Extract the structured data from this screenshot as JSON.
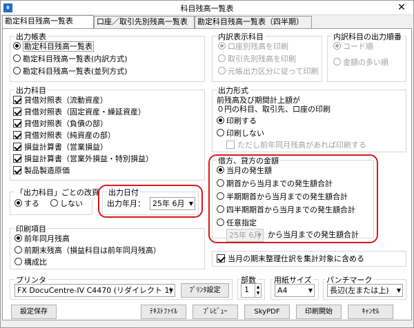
{
  "window": {
    "title": "科目残高一覧表",
    "app_icon": "B"
  },
  "tabs": [
    "勘定科目残高一覧表",
    "口座／取引先別残高一覧表",
    "勘定科目残高一覧表（四半期）"
  ],
  "output_ledger": {
    "legend": "出力帳表",
    "options": [
      "勘定科目残高一覧表",
      "勘定科目残高一覧表(内訳方式)",
      "勘定科目残高一覧表(並列方式)"
    ],
    "selected": 0
  },
  "breakdown": {
    "legend": "内訳表示科目",
    "options": [
      "口座別残高を印刷",
      "取引先別残高を印刷",
      "元帳出力区分に従って印刷"
    ]
  },
  "breakdown_order": {
    "legend": "内訳科目の出力順番",
    "options": [
      "コード順",
      "金額の多い順"
    ]
  },
  "output_accounts": {
    "legend": "出力科目",
    "items": [
      "貸借対照表（流動資産）",
      "貸借対照表（固定資産・繰延資産）",
      "貸借対照表（負債の部）",
      "貸借対照表（純資産の部）",
      "損益計算書（営業損益）",
      "損益計算書（営業外損益・特別損益）",
      "製品製造原価"
    ]
  },
  "output_format": {
    "legend": "出力形式",
    "desc1": "前残高及び期間計上額が",
    "desc2": "０円の科目、取引先、口座の印刷",
    "options": [
      "印刷する",
      "印刷しない"
    ],
    "sub_check": "ただし前年同月残高があれば印刷する"
  },
  "page_break": {
    "legend": "「出力科目」ごとの改頁",
    "options": [
      "する",
      "しない"
    ]
  },
  "output_date": {
    "legend": "出力日付",
    "label": "出力年月：",
    "value": "25年 6月"
  },
  "amount": {
    "legend": "借方、貸方の金額",
    "options": [
      "当月の発生額",
      "期首から当月までの発生額合計",
      "半期期首から当月までの発生額合計",
      "四半期期首から当月までの発生額合計",
      "任意指定"
    ],
    "custom_value": "25年 6月",
    "custom_suffix": "から当月までの発生額合計"
  },
  "print_items": {
    "legend": "印刷項目",
    "options": [
      "前年同月残高",
      "前期末残高（損益科目は前年同月残高）",
      "構成比"
    ]
  },
  "period_end_check": "当月の期末整理仕訳を集計対象に含める",
  "printer": {
    "legend": "プリンタ",
    "value": "FX DocuCentre-IV C4470 (リダイレクト 1)",
    "settings_button": "ﾌﾟﾘﾝﾀ設定"
  },
  "copies": {
    "legend": "部数",
    "value": "1"
  },
  "paper": {
    "legend": "用紙サイズ",
    "value": "A4"
  },
  "punch": {
    "legend": "パンチマーク",
    "value": "長辺(左または上)"
  },
  "buttons": {
    "save": "設定保存",
    "text_file": "ﾃｷｽﾄﾌｧｲﾙ",
    "preview": "ﾌﾟﾚﾋﾞｭｰ",
    "skypdf": "SkyPDF",
    "print": "印刷開始",
    "cancel": "ｷｬﾝｾﾙ"
  },
  "colors": {
    "highlight": "#d6161a",
    "disabled": "#a0a0a0"
  }
}
